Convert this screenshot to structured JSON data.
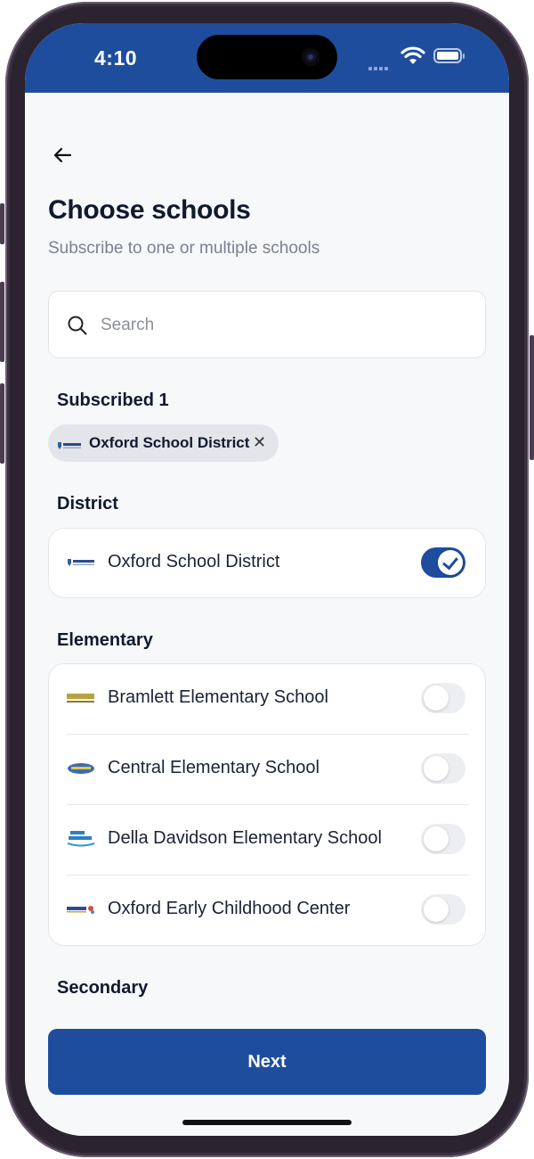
{
  "status_bar": {
    "time": "4:10"
  },
  "header": {
    "title": "Choose schools",
    "subtitle": "Subscribe to one or multiple schools"
  },
  "search": {
    "placeholder": "Search",
    "value": ""
  },
  "subscribed": {
    "label": "Subscribed 1",
    "chips": [
      {
        "label": "Oxford School District"
      }
    ]
  },
  "district": {
    "label": "District",
    "items": [
      {
        "label": "Oxford School District",
        "on": true
      }
    ]
  },
  "elementary": {
    "label": "Elementary",
    "items": [
      {
        "label": "Bramlett Elementary School",
        "on": false
      },
      {
        "label": "Central Elementary School",
        "on": false
      },
      {
        "label": "Della Davidson Elementary School",
        "on": false
      },
      {
        "label": "Oxford Early Childhood Center",
        "on": false
      }
    ]
  },
  "secondary": {
    "label": "Secondary"
  },
  "footer": {
    "next_label": "Next"
  },
  "colors": {
    "accent": "#1f4d9e",
    "text": "#0f1a2e",
    "muted": "#7a8190"
  }
}
